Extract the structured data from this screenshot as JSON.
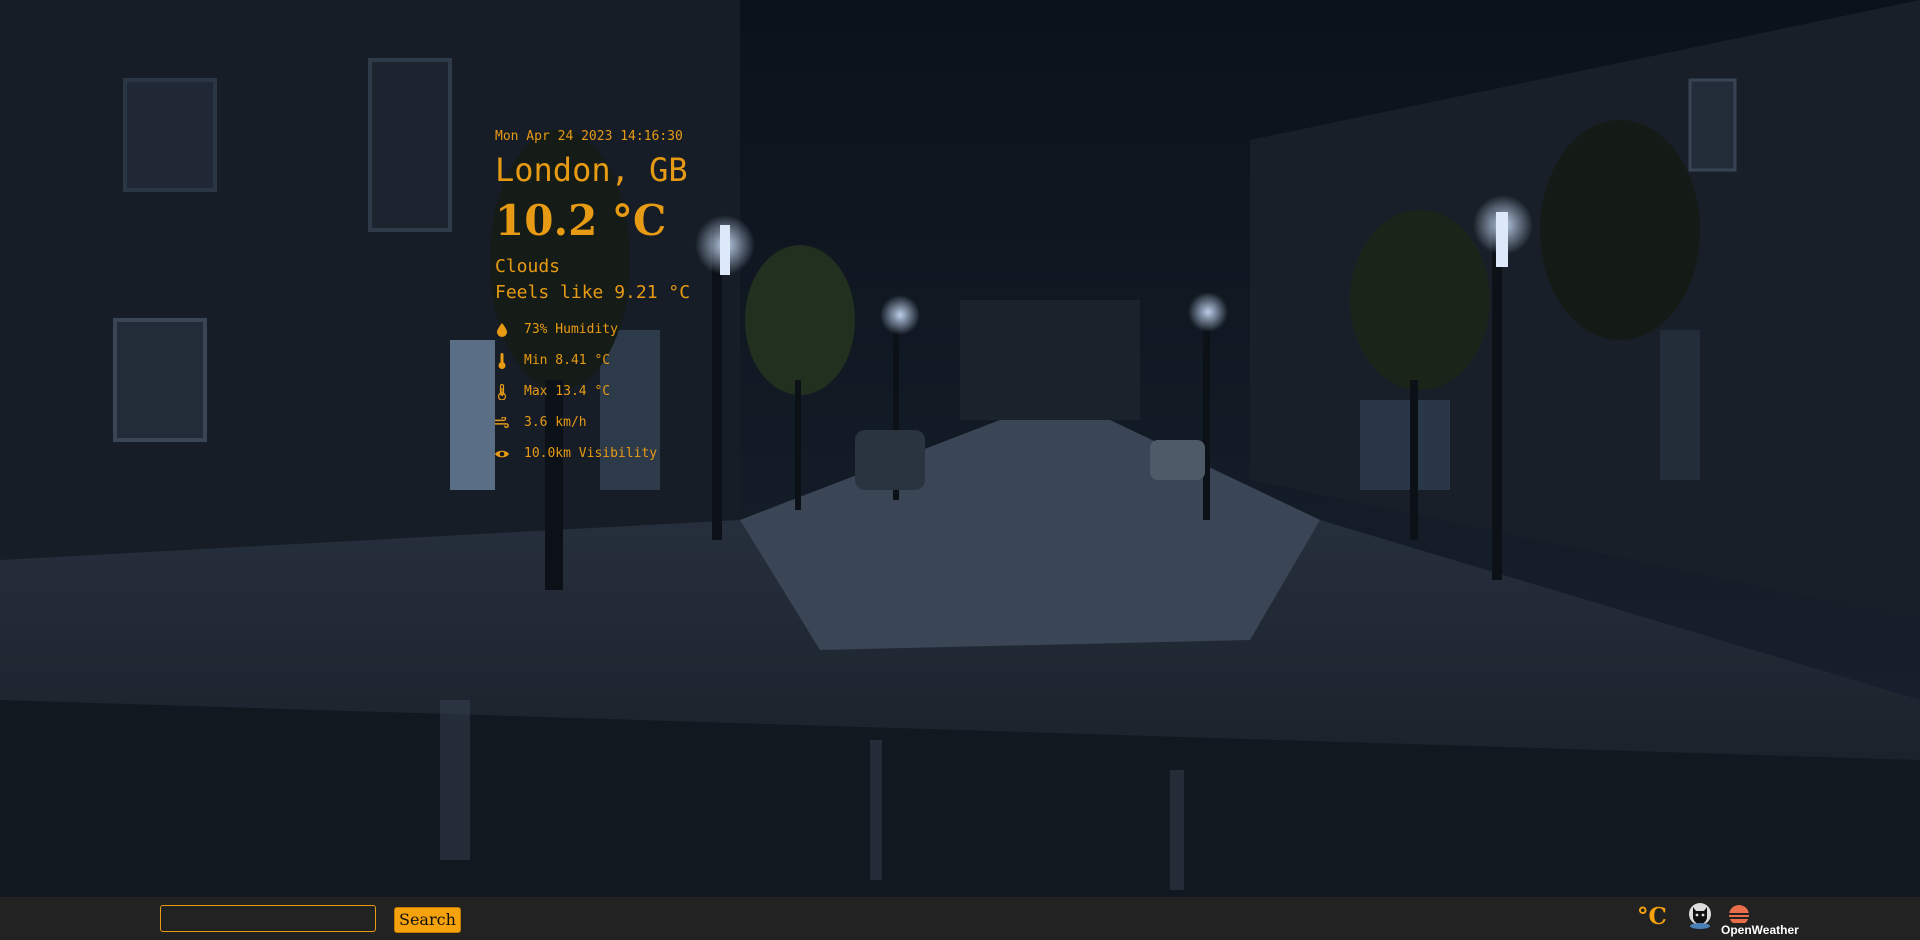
{
  "weather": {
    "datetime": "Mon Apr 24 2023 14:16:30",
    "location": "London, GB",
    "temperature": "10.2 °C",
    "condition": "Clouds",
    "feels_like": "Feels like 9.21 °C",
    "stats": {
      "humidity": "73% Humidity",
      "min": "Min 8.41 °C",
      "max": "Max 13.4 °C",
      "wind": "3.6 km/h",
      "visibility": "10.0km Visibility"
    }
  },
  "search": {
    "button_label": "Search",
    "value": ""
  },
  "footer": {
    "unit_toggle": "°C",
    "provider": "OpenWeather"
  },
  "colors": {
    "accent": "#e79a13",
    "bar": "#222222"
  },
  "icons": [
    "droplet-icon",
    "thermometer-low-icon",
    "thermometer-high-icon",
    "wind-icon",
    "eye-icon",
    "github-icon",
    "openweather-logo"
  ]
}
